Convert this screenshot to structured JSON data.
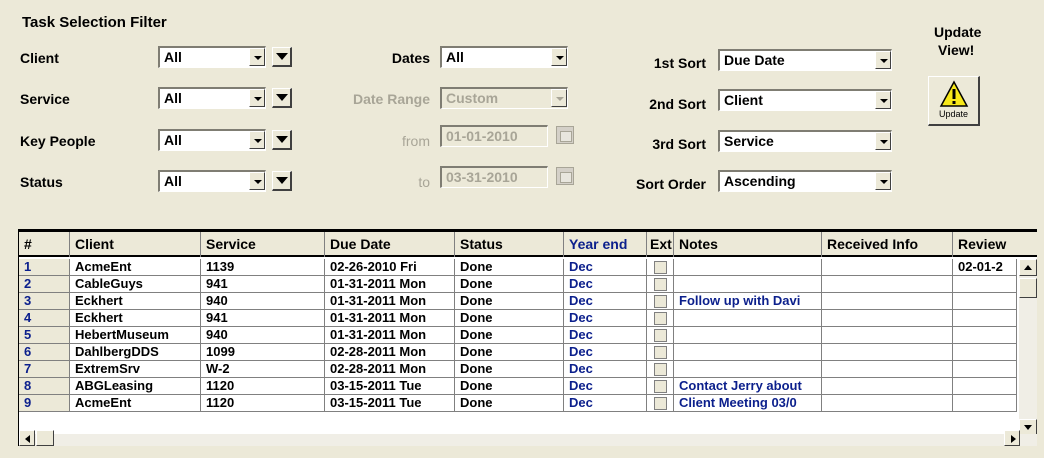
{
  "filter": {
    "title": "Task Selection Filter",
    "client": {
      "label": "Client",
      "value": "All"
    },
    "service": {
      "label": "Service",
      "value": "All"
    },
    "key_people": {
      "label": "Key People",
      "value": "All"
    },
    "status": {
      "label": "Status",
      "value": "All"
    },
    "dates": {
      "label": "Dates",
      "value": "All"
    },
    "date_range": {
      "label": "Date Range",
      "value": "Custom"
    },
    "from": {
      "label": "from",
      "value": "01-01-2010"
    },
    "to": {
      "label": "to",
      "value": "03-31-2010"
    },
    "sort1": {
      "label": "1st Sort",
      "value": "Due Date"
    },
    "sort2": {
      "label": "2nd Sort",
      "value": "Client"
    },
    "sort3": {
      "label": "3rd Sort",
      "value": "Service"
    },
    "sort_order": {
      "label": "Sort Order",
      "value": "Ascending"
    }
  },
  "update": {
    "title_line1": "Update",
    "title_line2": "View!",
    "button_label": "Update",
    "icon": "warning-icon"
  },
  "grid": {
    "columns": [
      "#",
      "Client",
      "Service",
      "Due Date",
      "Status",
      "Year end",
      "Ext",
      "Notes",
      "Received Info",
      "Review"
    ],
    "rows": [
      {
        "num": "1",
        "client": "AcmeEnt",
        "service": "1139",
        "due": "02-26-2010 Fri",
        "status": "Done",
        "year_end": "Dec",
        "notes": "",
        "received": "",
        "review": "02-01-2"
      },
      {
        "num": "2",
        "client": "CableGuys",
        "service": "941",
        "due": "01-31-2011 Mon",
        "status": "Done",
        "year_end": "Dec",
        "notes": "",
        "received": "",
        "review": ""
      },
      {
        "num": "3",
        "client": "Eckhert",
        "service": "940",
        "due": "01-31-2011 Mon",
        "status": "Done",
        "year_end": "Dec",
        "notes": "Follow up with Davi",
        "received": "",
        "review": ""
      },
      {
        "num": "4",
        "client": "Eckhert",
        "service": "941",
        "due": "01-31-2011 Mon",
        "status": "Done",
        "year_end": "Dec",
        "notes": "",
        "received": "",
        "review": ""
      },
      {
        "num": "5",
        "client": "HebertMuseum",
        "service": "940",
        "due": "01-31-2011 Mon",
        "status": "Done",
        "year_end": "Dec",
        "notes": "",
        "received": "",
        "review": ""
      },
      {
        "num": "6",
        "client": "DahlbergDDS",
        "service": "1099",
        "due": "02-28-2011 Mon",
        "status": "Done",
        "year_end": "Dec",
        "notes": "",
        "received": "",
        "review": ""
      },
      {
        "num": "7",
        "client": "ExtremSrv",
        "service": "W-2",
        "due": "02-28-2011 Mon",
        "status": "Done",
        "year_end": "Dec",
        "notes": "",
        "received": "",
        "review": ""
      },
      {
        "num": "8",
        "client": "ABGLeasing",
        "service": "1120",
        "due": "03-15-2011 Tue",
        "status": "Done",
        "year_end": "Dec",
        "notes": "Contact Jerry about",
        "received": "",
        "review": ""
      },
      {
        "num": "9",
        "client": "AcmeEnt",
        "service": "1120",
        "due": "03-15-2011 Tue",
        "status": "Done",
        "year_end": "Dec",
        "notes": "Client Meeting 03/0",
        "received": "",
        "review": ""
      }
    ]
  }
}
